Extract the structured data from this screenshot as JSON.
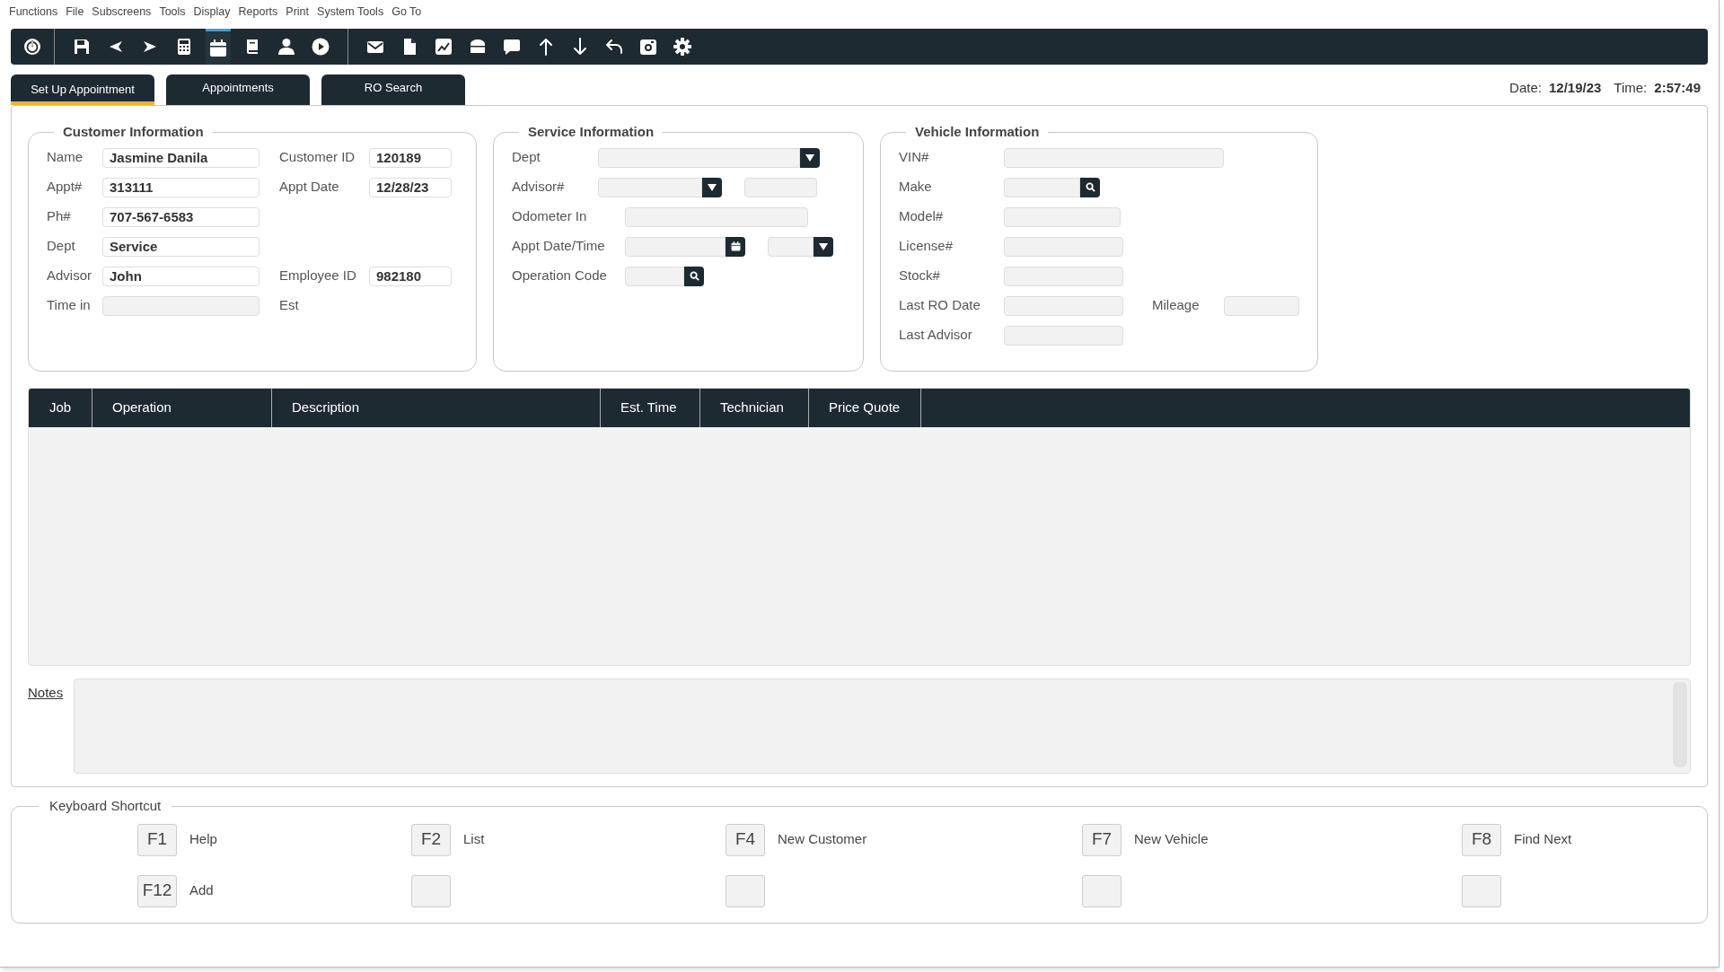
{
  "menu": [
    "Functions",
    "File",
    "Subscreens",
    "Tools",
    "Display",
    "Reports",
    "Print",
    "System Tools",
    "Go To"
  ],
  "toolbar": [
    [
      {
        "kind": "power",
        "selected": false
      }
    ],
    [
      {
        "kind": "save",
        "selected": false
      },
      {
        "kind": "left",
        "selected": false
      },
      {
        "kind": "right",
        "selected": false
      },
      {
        "kind": "calculator",
        "selected": false
      },
      {
        "kind": "calendar",
        "selected": true
      },
      {
        "kind": "book",
        "selected": false
      },
      {
        "kind": "person",
        "selected": false
      },
      {
        "kind": "play",
        "selected": false
      }
    ],
    [
      {
        "kind": "mail",
        "selected": false
      },
      {
        "kind": "document",
        "selected": false
      },
      {
        "kind": "chart",
        "selected": false
      },
      {
        "kind": "box",
        "selected": false
      },
      {
        "kind": "chat",
        "selected": false
      },
      {
        "kind": "up",
        "selected": false
      },
      {
        "kind": "down",
        "selected": false
      },
      {
        "kind": "undo",
        "selected": false
      },
      {
        "kind": "camera",
        "selected": false
      },
      {
        "kind": "gear",
        "selected": false
      }
    ]
  ],
  "tabs": [
    {
      "label": "Set Up Appointment",
      "selected": true
    },
    {
      "label": "Appointments",
      "selected": false
    },
    {
      "label": "RO Search",
      "selected": false
    }
  ],
  "date_label": "Date:",
  "date": "12/19/23",
  "time_label": "Time:",
  "time": "2:57:49",
  "customer": {
    "title": "Customer Information",
    "rows": [
      [
        {
          "label": "Name",
          "kind": "text",
          "value": "Jasmine Danila"
        },
        {
          "label": "Customer ID",
          "kind": "text",
          "value": "120189"
        }
      ],
      [
        {
          "label": "Appt#",
          "kind": "text",
          "value": "313111"
        },
        {
          "label": "Appt Date",
          "kind": "text",
          "value": "12/28/23"
        }
      ],
      [
        {
          "label": "Ph#",
          "kind": "text",
          "value": "707-567-6583"
        }
      ],
      [
        {
          "label": "Dept",
          "kind": "text",
          "value": "Service"
        }
      ],
      [
        {
          "label": "Advisor",
          "kind": "text",
          "value": "John"
        },
        {
          "label": "Employee ID",
          "kind": "text",
          "value": "982180"
        }
      ],
      [
        {
          "label": "Time in",
          "kind": "text"
        },
        {
          "label": "Est",
          "kind": "label"
        }
      ]
    ]
  },
  "service": {
    "title": "Service Information",
    "rows": [
      [
        {
          "label": "Dept",
          "kind": "dropdown"
        }
      ],
      [
        {
          "label": "Advisor#",
          "kind": "dropdown"
        },
        {
          "kind": "text"
        }
      ],
      [
        {
          "label": "Odometer In",
          "kind": "text"
        }
      ],
      [
        {
          "label": "Appt Date/Time",
          "kind": "date"
        },
        {
          "kind": "dropdown"
        }
      ],
      [
        {
          "label": "Operation Code",
          "kind": "search"
        }
      ]
    ]
  },
  "vehicle": {
    "title": "Vehicle Information",
    "rows": [
      [
        {
          "label": "VIN#",
          "kind": "text"
        }
      ],
      [
        {
          "label": "Make",
          "kind": "search"
        }
      ],
      [
        {
          "label": "Model#",
          "kind": "text"
        }
      ],
      [
        {
          "label": "License#",
          "kind": "text"
        }
      ],
      [
        {
          "label": "Stock#",
          "kind": "text"
        }
      ],
      [
        {
          "label": "Last RO Date",
          "kind": "text"
        },
        {
          "label": "Mileage",
          "kind": "text"
        }
      ],
      [
        {
          "label": "Last Advisor",
          "kind": "text"
        }
      ]
    ]
  },
  "table": {
    "columns": [
      "Job",
      "Operation",
      "Description",
      "Est. Time",
      "Technician",
      "Price Quote"
    ]
  },
  "notes": {
    "label": "Notes"
  },
  "shortcuts": {
    "title": "Keyboard Shortcut",
    "items": [
      {
        "kind": "key",
        "key": "F1",
        "label": "Help"
      },
      {
        "kind": "key",
        "key": "F2",
        "label": "List"
      },
      {
        "kind": "key",
        "key": "F4",
        "label": "New Customer"
      },
      {
        "kind": "key",
        "key": "F7",
        "label": "New Vehicle"
      },
      {
        "kind": "key",
        "key": "F8",
        "label": "Find Next"
      },
      {
        "kind": "key",
        "key": "F12",
        "label": "Add"
      },
      {
        "kind": "blank"
      },
      {
        "kind": "blank"
      },
      {
        "kind": "blank"
      },
      {
        "kind": "blank"
      }
    ]
  }
}
